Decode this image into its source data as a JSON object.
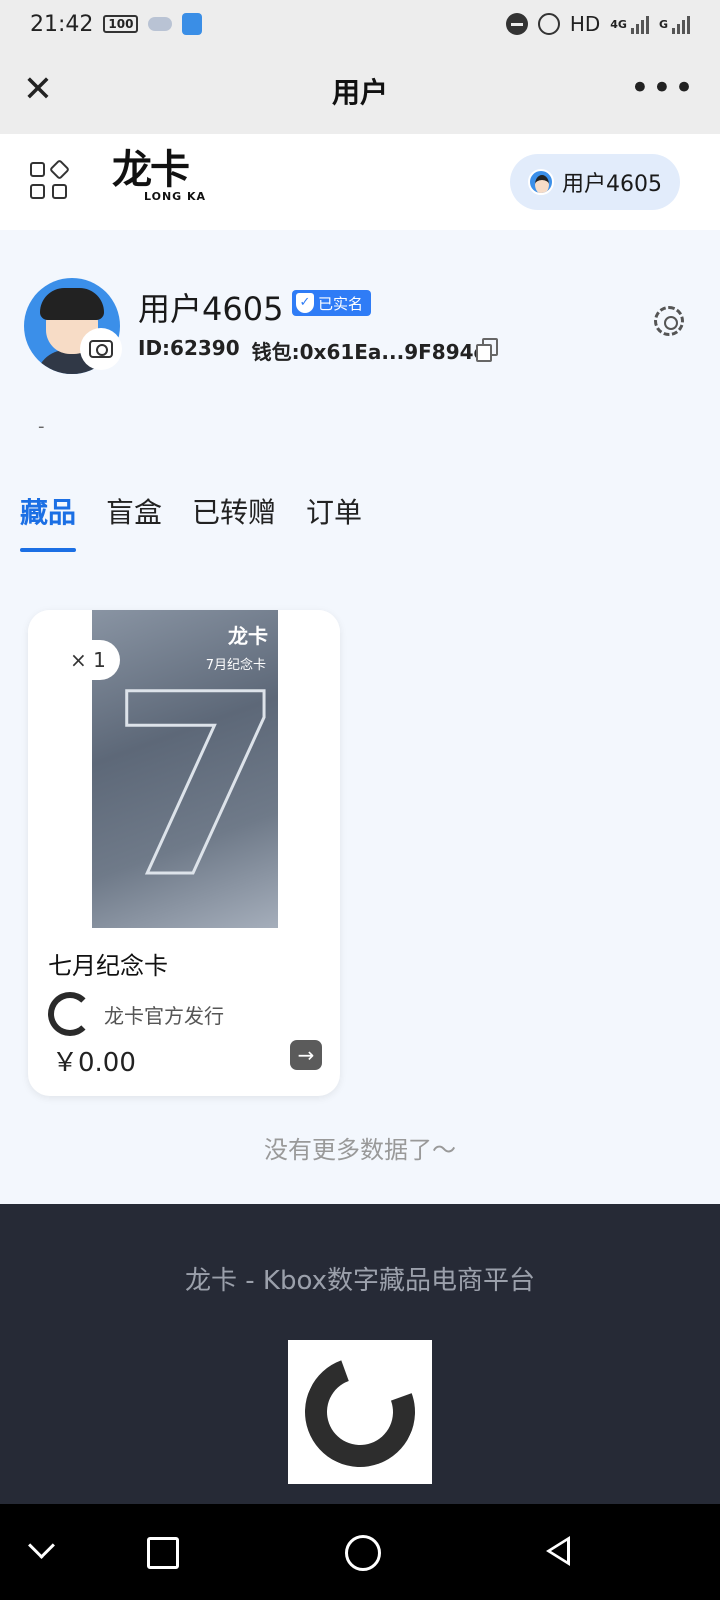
{
  "status_bar": {
    "time": "21:42",
    "battery": "100",
    "network": "HD",
    "network_gen_1": "4G",
    "network_gen_2": "G"
  },
  "navbar": {
    "title": "用户",
    "close_icon": "close-icon",
    "more_icon": "more-icon"
  },
  "app_header": {
    "logo_text": "龙卡",
    "logo_subtext": "LONG KA",
    "user_pill_label": "用户4605"
  },
  "profile": {
    "username": "用户4605",
    "verified_label": "已实名",
    "id_text": "ID:62390",
    "wallet_text": "钱包:0x61Ea...9F894e",
    "bio": "-"
  },
  "tabs": [
    {
      "label": "藏品",
      "active": true
    },
    {
      "label": "盲盒",
      "active": false
    },
    {
      "label": "已转赠",
      "active": false
    },
    {
      "label": "订单",
      "active": false
    }
  ],
  "collection": [
    {
      "quantity": "× 1",
      "art_logo": "龙卡",
      "art_subtitle": "7月纪念卡",
      "art_number": "7",
      "title": "七月纪念卡",
      "issuer": "龙卡官方发行",
      "price": "￥0.00"
    }
  ],
  "no_more_text": "没有更多数据了～",
  "footer": {
    "text": "龙卡 - Kbox数字藏品电商平台"
  },
  "colors": {
    "accent": "#1b6fe4",
    "verified": "#2f7cf6",
    "footer_bg": "#262a36",
    "page_bg": "#f3f7fd"
  }
}
